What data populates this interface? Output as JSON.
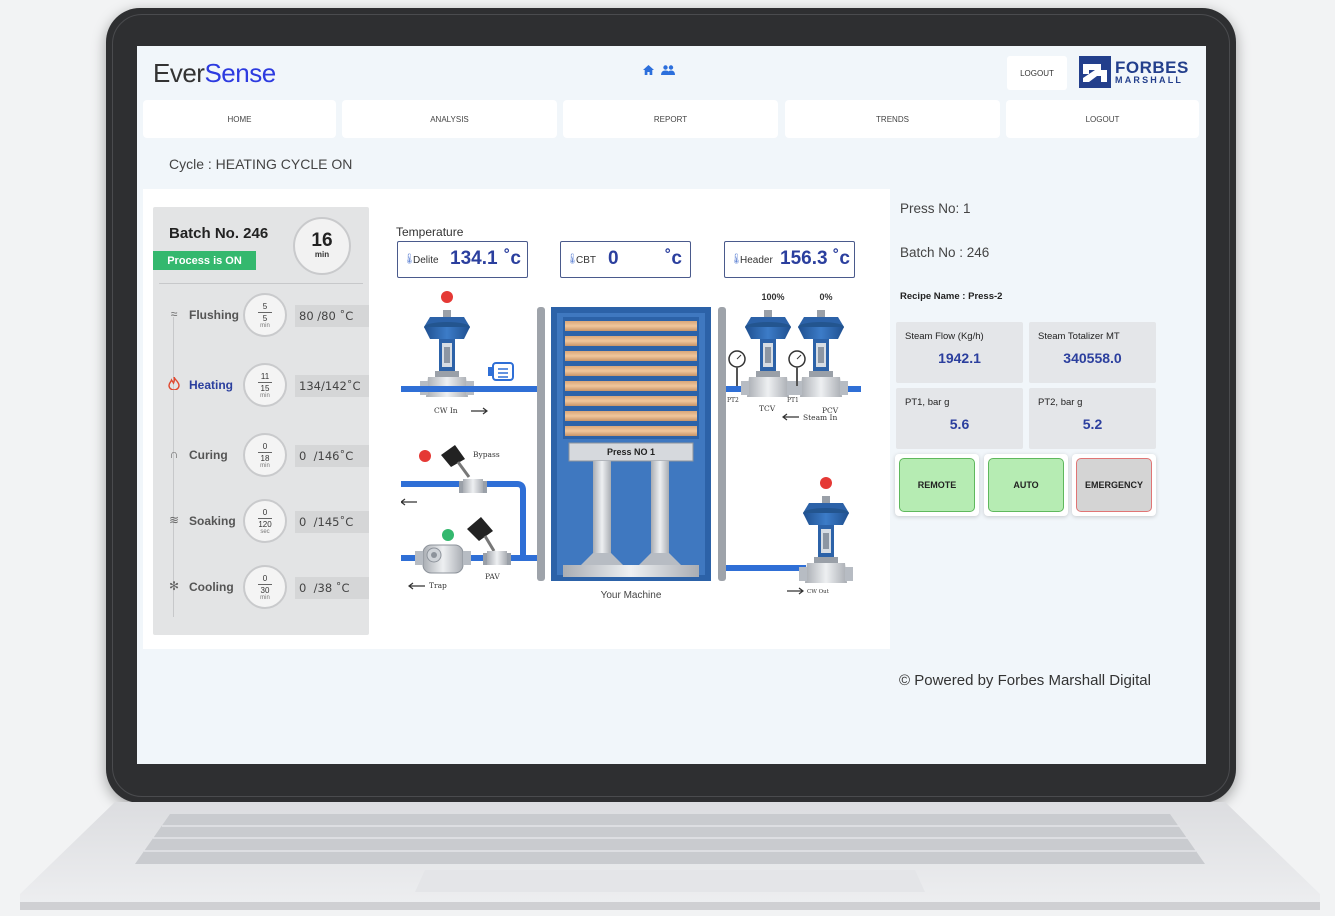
{
  "header": {
    "logo_prefix": "Ever",
    "logo_suffix": "Sense",
    "logout_label": "LOGOUT",
    "brand_line1": "FORBES",
    "brand_line2": "MARSHALL",
    "home_icon": "home-icon",
    "users_icon": "users-icon"
  },
  "nav": {
    "items": [
      {
        "label": "HOME"
      },
      {
        "label": "ANALYSIS"
      },
      {
        "label": "REPORT"
      },
      {
        "label": "TRENDS"
      },
      {
        "label": "LOGOUT"
      }
    ]
  },
  "cycle": {
    "text": "Cycle : HEATING CYCLE ON"
  },
  "batch": {
    "title": "Batch No. 246",
    "status": "Process is ON",
    "timer_value": "16",
    "timer_unit": "min",
    "stages": [
      {
        "name": "Flushing",
        "icon": "flushing-icon",
        "elapsed": "5",
        "total": "5",
        "unit": "min",
        "temp": "80 /80 ˚C",
        "active": false
      },
      {
        "name": "Heating",
        "icon": "heating-icon",
        "elapsed": "11",
        "total": "15",
        "unit": "min",
        "temp": "134/142˚C",
        "active": true
      },
      {
        "name": "Curing",
        "icon": "curing-icon",
        "elapsed": "0",
        "total": "18",
        "unit": "min",
        "temp": "0  /146˚C",
        "active": false
      },
      {
        "name": "Soaking",
        "icon": "soaking-icon",
        "elapsed": "0",
        "total": "120",
        "unit": "sec",
        "temp": "0  /145˚C",
        "active": false
      },
      {
        "name": "Cooling",
        "icon": "cooling-icon",
        "elapsed": "0",
        "total": "30",
        "unit": "min",
        "temp": "0  /38 ˚C",
        "active": false
      }
    ]
  },
  "temperature": {
    "heading": "Temperature",
    "delite_label": "Delite",
    "delite_value": "134.1",
    "cbt_label": "CBT",
    "cbt_value": "0",
    "header_label": "Header",
    "header_value": "156.3",
    "unit": "˚c"
  },
  "diagram": {
    "tcv_percent": "100%",
    "pcv_percent": "0%",
    "cw_in": "CW In",
    "bypass": "Bypass",
    "trap": "Trap",
    "pav": "PAV",
    "pt2": "PT2",
    "pt1": "PT1",
    "tcv": "TCV",
    "pcv": "PCV",
    "steam_in": "Steam In",
    "press_label": "Press NO 1",
    "machine_caption": "Your Machine",
    "cw_out": "CW Out",
    "indicator_red": "#e53935",
    "indicator_green": "#34b86e",
    "pipe_color": "#2f6fd6",
    "press_blue": "#2c62a8"
  },
  "side": {
    "press_no": "Press No: 1",
    "batch_no": "Batch No : 246",
    "recipe": "Recipe Name : Press-2",
    "metrics": [
      {
        "label": "Steam Flow (Kg/h)",
        "value": "1942.1"
      },
      {
        "label": "Steam Totalizer MT",
        "value": "340558.0"
      },
      {
        "label": "PT1, bar g",
        "value": "5.6"
      },
      {
        "label": "PT2, bar g",
        "value": "5.2"
      }
    ],
    "buttons": {
      "remote": "REMOTE",
      "auto": "AUTO",
      "emergency": "EMERGENCY"
    }
  },
  "footer": {
    "powered": "© Powered by Forbes Marshall Digital"
  }
}
